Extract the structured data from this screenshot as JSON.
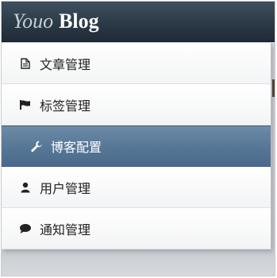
{
  "brand": {
    "prefix": "Youo",
    "name": "Blog"
  },
  "menu": {
    "items": [
      {
        "label": "文章管理",
        "icon": "document-icon",
        "active": false
      },
      {
        "label": "标签管理",
        "icon": "flag-icon",
        "active": false
      },
      {
        "label": "博客配置",
        "icon": "wrench-icon",
        "active": true
      },
      {
        "label": "用户管理",
        "icon": "user-icon",
        "active": false
      },
      {
        "label": "通知管理",
        "icon": "comment-icon",
        "active": false
      }
    ]
  },
  "colors": {
    "topbar": "#2c3a47",
    "active_item": "#567696",
    "menu_bg": "#f7f8f9"
  }
}
